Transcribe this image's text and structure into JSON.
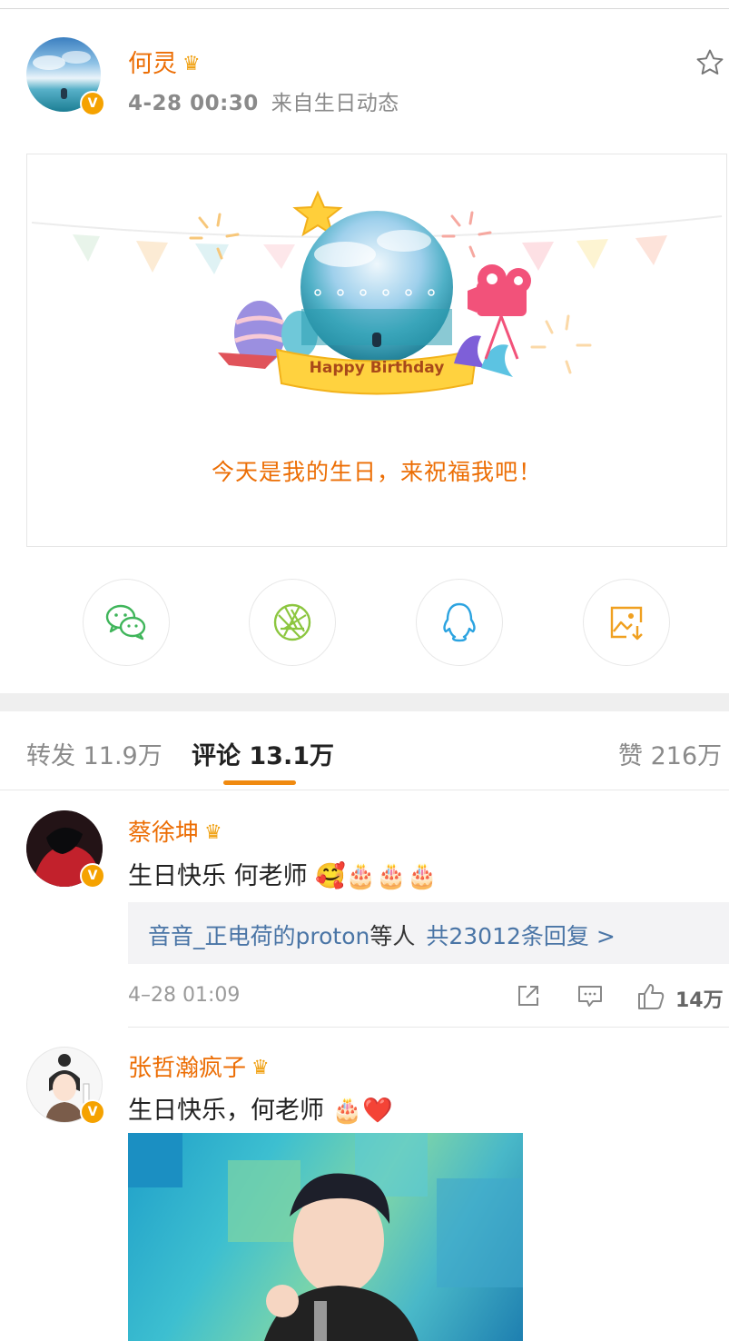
{
  "post": {
    "author": "何灵",
    "crown_icon": "crown-icon",
    "time": "4-28 00:30",
    "source": "来自生日动态",
    "card": {
      "banner_text": "Happy Birthday",
      "message": "今天是我的生日，来祝福我吧！"
    },
    "share": [
      {
        "icon": "wechat-icon"
      },
      {
        "icon": "moments-icon"
      },
      {
        "icon": "qq-icon"
      },
      {
        "icon": "save-image-icon"
      }
    ]
  },
  "tabs": {
    "repost": "转发 11.9万",
    "comments": "评论 13.1万",
    "likes": "赞 216万"
  },
  "comments": [
    {
      "name": "蔡徐坤",
      "text": "生日快乐 何老师 🥰🎂🎂🎂",
      "reply_user": "音音_正电荷的proton",
      "reply_mid": "等人",
      "reply_count": "共23012条回复 >",
      "time": "4–28 01:09",
      "likes": "14万"
    },
    {
      "name": "张哲瀚疯子",
      "text": "生日快乐，何老师 🎂❤️"
    }
  ],
  "colors": {
    "accent": "#ec6e05",
    "link": "#4a75a6",
    "verified": "#f5a200"
  }
}
